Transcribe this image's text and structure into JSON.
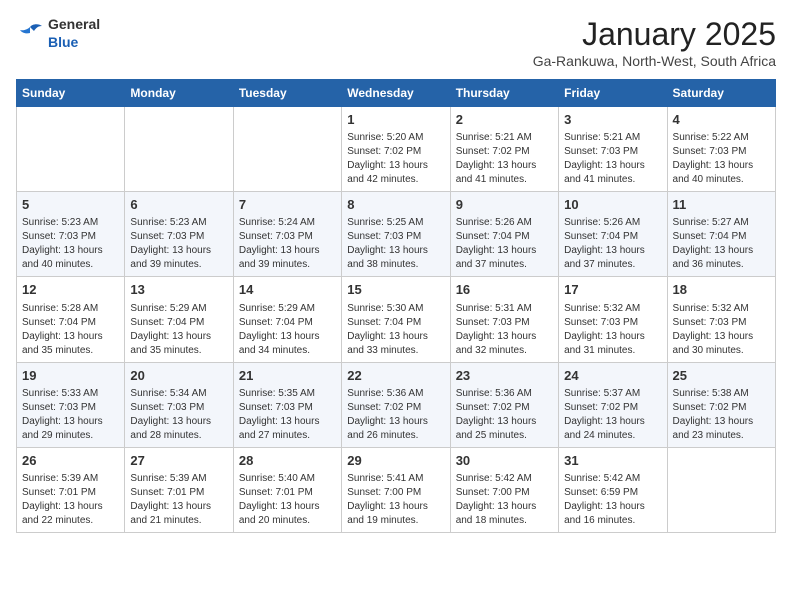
{
  "header": {
    "logo_general": "General",
    "logo_blue": "Blue",
    "month_title": "January 2025",
    "subtitle": "Ga-Rankuwa, North-West, South Africa"
  },
  "weekdays": [
    "Sunday",
    "Monday",
    "Tuesday",
    "Wednesday",
    "Thursday",
    "Friday",
    "Saturday"
  ],
  "weeks": [
    [
      {
        "day": "",
        "empty": true
      },
      {
        "day": "",
        "empty": true
      },
      {
        "day": "",
        "empty": true
      },
      {
        "day": "1",
        "sunrise": "5:20 AM",
        "sunset": "7:02 PM",
        "daylight": "13 hours and 42 minutes."
      },
      {
        "day": "2",
        "sunrise": "5:21 AM",
        "sunset": "7:02 PM",
        "daylight": "13 hours and 41 minutes."
      },
      {
        "day": "3",
        "sunrise": "5:21 AM",
        "sunset": "7:03 PM",
        "daylight": "13 hours and 41 minutes."
      },
      {
        "day": "4",
        "sunrise": "5:22 AM",
        "sunset": "7:03 PM",
        "daylight": "13 hours and 40 minutes."
      }
    ],
    [
      {
        "day": "5",
        "sunrise": "5:23 AM",
        "sunset": "7:03 PM",
        "daylight": "13 hours and 40 minutes."
      },
      {
        "day": "6",
        "sunrise": "5:23 AM",
        "sunset": "7:03 PM",
        "daylight": "13 hours and 39 minutes."
      },
      {
        "day": "7",
        "sunrise": "5:24 AM",
        "sunset": "7:03 PM",
        "daylight": "13 hours and 39 minutes."
      },
      {
        "day": "8",
        "sunrise": "5:25 AM",
        "sunset": "7:03 PM",
        "daylight": "13 hours and 38 minutes."
      },
      {
        "day": "9",
        "sunrise": "5:26 AM",
        "sunset": "7:04 PM",
        "daylight": "13 hours and 37 minutes."
      },
      {
        "day": "10",
        "sunrise": "5:26 AM",
        "sunset": "7:04 PM",
        "daylight": "13 hours and 37 minutes."
      },
      {
        "day": "11",
        "sunrise": "5:27 AM",
        "sunset": "7:04 PM",
        "daylight": "13 hours and 36 minutes."
      }
    ],
    [
      {
        "day": "12",
        "sunrise": "5:28 AM",
        "sunset": "7:04 PM",
        "daylight": "13 hours and 35 minutes."
      },
      {
        "day": "13",
        "sunrise": "5:29 AM",
        "sunset": "7:04 PM",
        "daylight": "13 hours and 35 minutes."
      },
      {
        "day": "14",
        "sunrise": "5:29 AM",
        "sunset": "7:04 PM",
        "daylight": "13 hours and 34 minutes."
      },
      {
        "day": "15",
        "sunrise": "5:30 AM",
        "sunset": "7:04 PM",
        "daylight": "13 hours and 33 minutes."
      },
      {
        "day": "16",
        "sunrise": "5:31 AM",
        "sunset": "7:03 PM",
        "daylight": "13 hours and 32 minutes."
      },
      {
        "day": "17",
        "sunrise": "5:32 AM",
        "sunset": "7:03 PM",
        "daylight": "13 hours and 31 minutes."
      },
      {
        "day": "18",
        "sunrise": "5:32 AM",
        "sunset": "7:03 PM",
        "daylight": "13 hours and 30 minutes."
      }
    ],
    [
      {
        "day": "19",
        "sunrise": "5:33 AM",
        "sunset": "7:03 PM",
        "daylight": "13 hours and 29 minutes."
      },
      {
        "day": "20",
        "sunrise": "5:34 AM",
        "sunset": "7:03 PM",
        "daylight": "13 hours and 28 minutes."
      },
      {
        "day": "21",
        "sunrise": "5:35 AM",
        "sunset": "7:03 PM",
        "daylight": "13 hours and 27 minutes."
      },
      {
        "day": "22",
        "sunrise": "5:36 AM",
        "sunset": "7:02 PM",
        "daylight": "13 hours and 26 minutes."
      },
      {
        "day": "23",
        "sunrise": "5:36 AM",
        "sunset": "7:02 PM",
        "daylight": "13 hours and 25 minutes."
      },
      {
        "day": "24",
        "sunrise": "5:37 AM",
        "sunset": "7:02 PM",
        "daylight": "13 hours and 24 minutes."
      },
      {
        "day": "25",
        "sunrise": "5:38 AM",
        "sunset": "7:02 PM",
        "daylight": "13 hours and 23 minutes."
      }
    ],
    [
      {
        "day": "26",
        "sunrise": "5:39 AM",
        "sunset": "7:01 PM",
        "daylight": "13 hours and 22 minutes."
      },
      {
        "day": "27",
        "sunrise": "5:39 AM",
        "sunset": "7:01 PM",
        "daylight": "13 hours and 21 minutes."
      },
      {
        "day": "28",
        "sunrise": "5:40 AM",
        "sunset": "7:01 PM",
        "daylight": "13 hours and 20 minutes."
      },
      {
        "day": "29",
        "sunrise": "5:41 AM",
        "sunset": "7:00 PM",
        "daylight": "13 hours and 19 minutes."
      },
      {
        "day": "30",
        "sunrise": "5:42 AM",
        "sunset": "7:00 PM",
        "daylight": "13 hours and 18 minutes."
      },
      {
        "day": "31",
        "sunrise": "5:42 AM",
        "sunset": "6:59 PM",
        "daylight": "13 hours and 16 minutes."
      },
      {
        "day": "",
        "empty": true
      }
    ]
  ]
}
